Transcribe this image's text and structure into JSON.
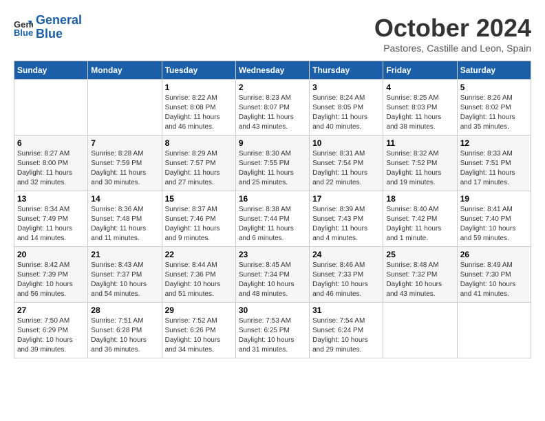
{
  "header": {
    "logo_line1": "General",
    "logo_line2": "Blue",
    "month_title": "October 2024",
    "subtitle": "Pastores, Castille and Leon, Spain"
  },
  "days_of_week": [
    "Sunday",
    "Monday",
    "Tuesday",
    "Wednesday",
    "Thursday",
    "Friday",
    "Saturday"
  ],
  "weeks": [
    [
      {
        "day": "",
        "info": ""
      },
      {
        "day": "",
        "info": ""
      },
      {
        "day": "1",
        "info": "Sunrise: 8:22 AM\nSunset: 8:08 PM\nDaylight: 11 hours and 46 minutes."
      },
      {
        "day": "2",
        "info": "Sunrise: 8:23 AM\nSunset: 8:07 PM\nDaylight: 11 hours and 43 minutes."
      },
      {
        "day": "3",
        "info": "Sunrise: 8:24 AM\nSunset: 8:05 PM\nDaylight: 11 hours and 40 minutes."
      },
      {
        "day": "4",
        "info": "Sunrise: 8:25 AM\nSunset: 8:03 PM\nDaylight: 11 hours and 38 minutes."
      },
      {
        "day": "5",
        "info": "Sunrise: 8:26 AM\nSunset: 8:02 PM\nDaylight: 11 hours and 35 minutes."
      }
    ],
    [
      {
        "day": "6",
        "info": "Sunrise: 8:27 AM\nSunset: 8:00 PM\nDaylight: 11 hours and 32 minutes."
      },
      {
        "day": "7",
        "info": "Sunrise: 8:28 AM\nSunset: 7:59 PM\nDaylight: 11 hours and 30 minutes."
      },
      {
        "day": "8",
        "info": "Sunrise: 8:29 AM\nSunset: 7:57 PM\nDaylight: 11 hours and 27 minutes."
      },
      {
        "day": "9",
        "info": "Sunrise: 8:30 AM\nSunset: 7:55 PM\nDaylight: 11 hours and 25 minutes."
      },
      {
        "day": "10",
        "info": "Sunrise: 8:31 AM\nSunset: 7:54 PM\nDaylight: 11 hours and 22 minutes."
      },
      {
        "day": "11",
        "info": "Sunrise: 8:32 AM\nSunset: 7:52 PM\nDaylight: 11 hours and 19 minutes."
      },
      {
        "day": "12",
        "info": "Sunrise: 8:33 AM\nSunset: 7:51 PM\nDaylight: 11 hours and 17 minutes."
      }
    ],
    [
      {
        "day": "13",
        "info": "Sunrise: 8:34 AM\nSunset: 7:49 PM\nDaylight: 11 hours and 14 minutes."
      },
      {
        "day": "14",
        "info": "Sunrise: 8:36 AM\nSunset: 7:48 PM\nDaylight: 11 hours and 11 minutes."
      },
      {
        "day": "15",
        "info": "Sunrise: 8:37 AM\nSunset: 7:46 PM\nDaylight: 11 hours and 9 minutes."
      },
      {
        "day": "16",
        "info": "Sunrise: 8:38 AM\nSunset: 7:44 PM\nDaylight: 11 hours and 6 minutes."
      },
      {
        "day": "17",
        "info": "Sunrise: 8:39 AM\nSunset: 7:43 PM\nDaylight: 11 hours and 4 minutes."
      },
      {
        "day": "18",
        "info": "Sunrise: 8:40 AM\nSunset: 7:42 PM\nDaylight: 11 hours and 1 minute."
      },
      {
        "day": "19",
        "info": "Sunrise: 8:41 AM\nSunset: 7:40 PM\nDaylight: 10 hours and 59 minutes."
      }
    ],
    [
      {
        "day": "20",
        "info": "Sunrise: 8:42 AM\nSunset: 7:39 PM\nDaylight: 10 hours and 56 minutes."
      },
      {
        "day": "21",
        "info": "Sunrise: 8:43 AM\nSunset: 7:37 PM\nDaylight: 10 hours and 54 minutes."
      },
      {
        "day": "22",
        "info": "Sunrise: 8:44 AM\nSunset: 7:36 PM\nDaylight: 10 hours and 51 minutes."
      },
      {
        "day": "23",
        "info": "Sunrise: 8:45 AM\nSunset: 7:34 PM\nDaylight: 10 hours and 48 minutes."
      },
      {
        "day": "24",
        "info": "Sunrise: 8:46 AM\nSunset: 7:33 PM\nDaylight: 10 hours and 46 minutes."
      },
      {
        "day": "25",
        "info": "Sunrise: 8:48 AM\nSunset: 7:32 PM\nDaylight: 10 hours and 43 minutes."
      },
      {
        "day": "26",
        "info": "Sunrise: 8:49 AM\nSunset: 7:30 PM\nDaylight: 10 hours and 41 minutes."
      }
    ],
    [
      {
        "day": "27",
        "info": "Sunrise: 7:50 AM\nSunset: 6:29 PM\nDaylight: 10 hours and 39 minutes."
      },
      {
        "day": "28",
        "info": "Sunrise: 7:51 AM\nSunset: 6:28 PM\nDaylight: 10 hours and 36 minutes."
      },
      {
        "day": "29",
        "info": "Sunrise: 7:52 AM\nSunset: 6:26 PM\nDaylight: 10 hours and 34 minutes."
      },
      {
        "day": "30",
        "info": "Sunrise: 7:53 AM\nSunset: 6:25 PM\nDaylight: 10 hours and 31 minutes."
      },
      {
        "day": "31",
        "info": "Sunrise: 7:54 AM\nSunset: 6:24 PM\nDaylight: 10 hours and 29 minutes."
      },
      {
        "day": "",
        "info": ""
      },
      {
        "day": "",
        "info": ""
      }
    ]
  ]
}
